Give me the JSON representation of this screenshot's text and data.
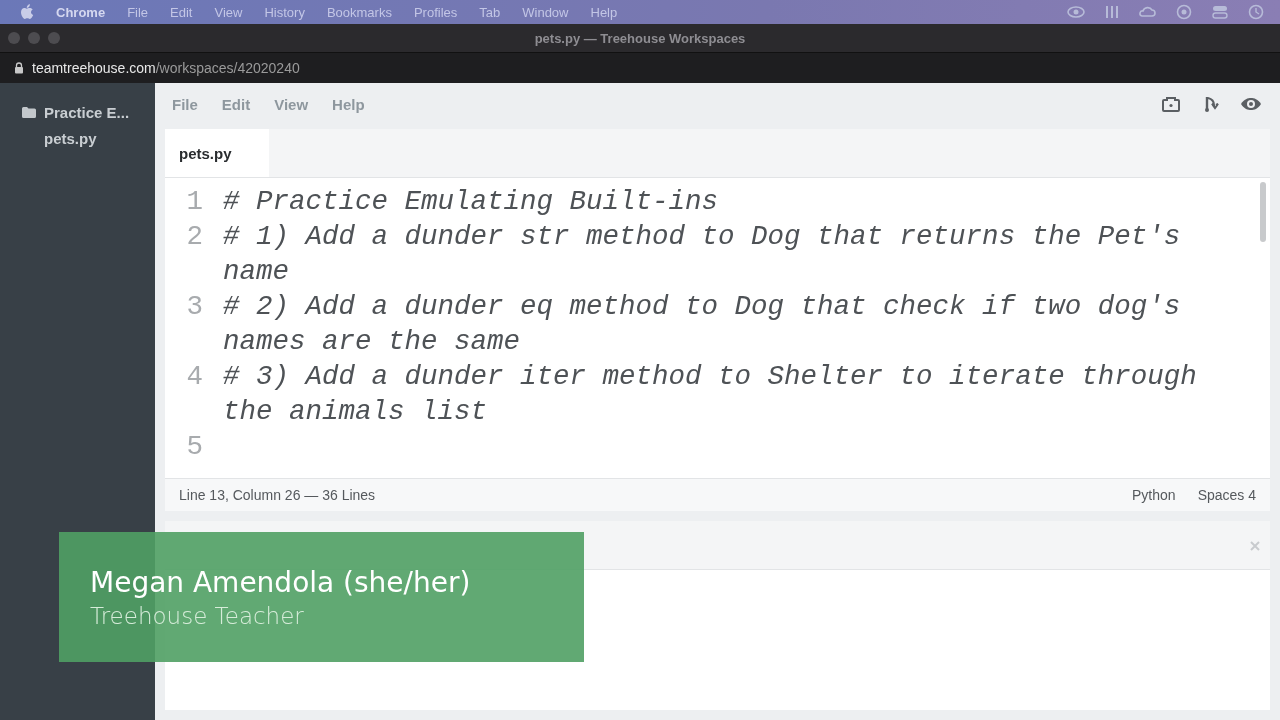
{
  "menu_bar": {
    "app": "Chrome",
    "items": [
      "File",
      "Edit",
      "View",
      "History",
      "Bookmarks",
      "Profiles",
      "Tab",
      "Window",
      "Help"
    ]
  },
  "window": {
    "title": "pets.py — Treehouse Workspaces"
  },
  "address_bar": {
    "host": "teamtreehouse.com",
    "path": "/workspaces/42020240"
  },
  "sidebar": {
    "items": [
      {
        "kind": "folder",
        "label": "Practice E..."
      },
      {
        "kind": "file",
        "label": "pets.py"
      }
    ]
  },
  "editor_menu": [
    "File",
    "Edit",
    "View",
    "Help"
  ],
  "tabs": [
    {
      "label": "pets.py",
      "selected": true
    }
  ],
  "code_lines": [
    {
      "number": "1",
      "segments": [
        {
          "kind": "comment",
          "text": "# Practice Emulating Built-ins"
        }
      ]
    },
    {
      "number": "2",
      "segments": [
        {
          "kind": "comment",
          "text": "# 1) Add a dunder str method to Dog that returns the Pet's name"
        }
      ]
    },
    {
      "number": "3",
      "segments": [
        {
          "kind": "comment",
          "text": "# 2) Add a dunder eq method to Dog that check if two dog's names are the same"
        }
      ]
    },
    {
      "number": "4",
      "segments": [
        {
          "kind": "comment",
          "text": "# 3) Add a dunder iter method to Shelter to iterate through the animals list"
        }
      ]
    },
    {
      "number": "5"
    }
  ],
  "status_bar": {
    "position": "Line 13, Column 26 — 36 Lines",
    "language": "Python",
    "indent": "Spaces 4"
  },
  "lower_third": {
    "name": "Megan Amendola (she/her)",
    "role": "Treehouse Teacher"
  }
}
